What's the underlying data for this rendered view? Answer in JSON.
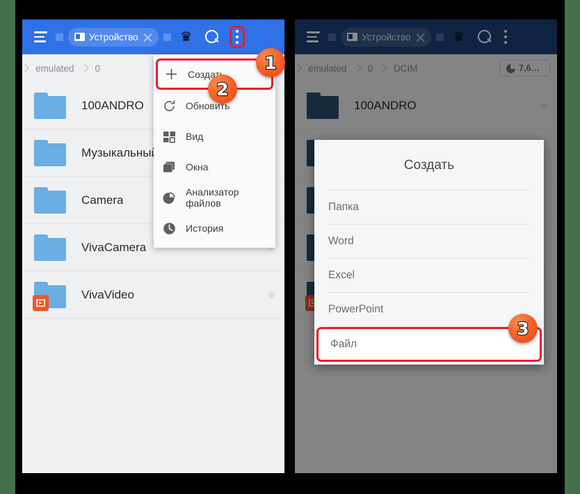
{
  "background_color": "#46704a",
  "accent_highlight": "#ee1c25",
  "bubble_color": "#f4642a",
  "left_panel": {
    "appbar": {
      "menu_icon": "hamburger-icon",
      "tab_label": "Устройство",
      "tab_close_icon": "close-icon",
      "premium_icon": "crown-icon",
      "crown_glyph": "♛",
      "search_icon": "search-icon",
      "overflow_icon": "overflow-menu-icon"
    },
    "breadcrumb": [
      "emulated",
      "0"
    ],
    "files": [
      {
        "name": "100ANDRO",
        "icon": "folder-icon",
        "has_dot": false,
        "app_badge": null
      },
      {
        "name": "Музыкальный ре",
        "icon": "folder-icon",
        "has_dot": false,
        "app_badge": null
      },
      {
        "name": "Camera",
        "icon": "folder-icon",
        "has_dot": false,
        "app_badge": null
      },
      {
        "name": "VivaCamera",
        "icon": "folder-icon",
        "has_dot": true,
        "app_badge": null
      },
      {
        "name": "VivaVideo",
        "icon": "folder-icon",
        "has_dot": true,
        "app_badge": "vivavideo-app-icon"
      }
    ],
    "popup_menu": [
      {
        "label": "Создать",
        "icon": "plus-icon",
        "highlighted": true
      },
      {
        "label": "Обновить",
        "icon": "refresh-icon",
        "highlighted": false
      },
      {
        "label": "Вид",
        "icon": "grid-view-icon",
        "highlighted": false
      },
      {
        "label": "Окна",
        "icon": "windows-icon",
        "highlighted": false
      },
      {
        "label": "Анализатор файлов",
        "icon": "pie-chart-icon",
        "highlighted": false
      },
      {
        "label": "История",
        "icon": "clock-icon",
        "highlighted": false
      }
    ]
  },
  "right_panel": {
    "appbar": {
      "menu_icon": "hamburger-icon",
      "tab_label": "Устройство",
      "tab_close_icon": "close-icon",
      "premium_icon": "crown-icon",
      "crown_glyph": "♛",
      "search_icon": "search-icon",
      "overflow_icon": "overflow-menu-icon"
    },
    "breadcrumb": [
      "emulated",
      "0",
      "DCIM"
    ],
    "storage_badge": {
      "icon": "pie-chart-icon",
      "label": "7,6…"
    },
    "files": [
      {
        "name": "100ANDRO",
        "icon": "folder-icon",
        "has_dot": true,
        "app_badge": null
      },
      {
        "name": "",
        "icon": "folder-icon",
        "has_dot": false,
        "app_badge": null
      },
      {
        "name": "",
        "icon": "folder-icon",
        "has_dot": false,
        "app_badge": null
      },
      {
        "name": "",
        "icon": "folder-icon",
        "has_dot": false,
        "app_badge": null
      },
      {
        "name": "",
        "icon": "folder-icon",
        "has_dot": false,
        "app_badge": "vivavideo-app-icon"
      }
    ],
    "dialog": {
      "title": "Создать",
      "options": [
        {
          "label": "Папка",
          "highlighted": false
        },
        {
          "label": "Word",
          "highlighted": false
        },
        {
          "label": "Excel",
          "highlighted": false
        },
        {
          "label": "PowerPoint",
          "highlighted": false
        },
        {
          "label": "Файл",
          "highlighted": true
        }
      ]
    }
  },
  "annotations": [
    {
      "number": "1",
      "target": "overflow-menu-button"
    },
    {
      "number": "2",
      "target": "create-menu-item"
    },
    {
      "number": "3",
      "target": "file-option"
    }
  ]
}
